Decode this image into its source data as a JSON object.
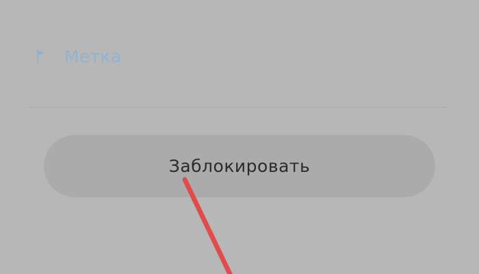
{
  "label_field": {
    "text": "Метка",
    "icon": "flag-icon"
  },
  "block_button": {
    "label": "Заблокировать"
  },
  "colors": {
    "background": "#b7b7b7",
    "label_text": "#8fb3d1",
    "button_bg": "#ababab",
    "button_text": "#2b2b2b",
    "annotation_arrow": "#e24b4b"
  }
}
